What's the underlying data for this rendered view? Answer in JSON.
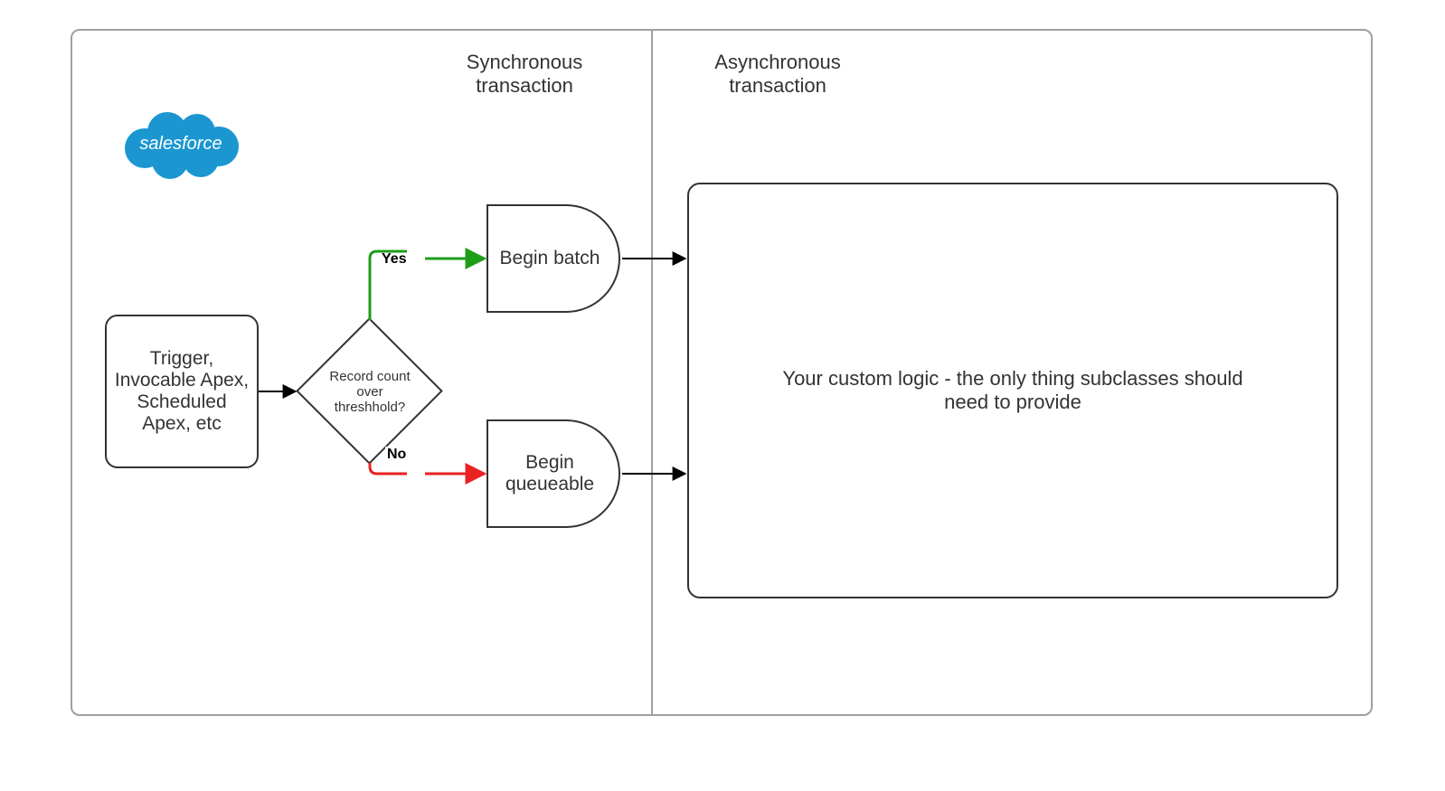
{
  "sections": {
    "sync_title": "Synchronous transaction",
    "async_title": "Asynchronous transaction"
  },
  "logo": {
    "text": "salesforce"
  },
  "nodes": {
    "entry": "Trigger, Invocable Apex, Scheduled Apex, etc",
    "decision": "Record count over threshhold?",
    "begin_batch": "Begin batch",
    "begin_queueable": "Begin queueable",
    "custom_logic": "Your custom logic - the only thing subclasses should need to provide"
  },
  "edges": {
    "yes": "Yes",
    "no": "No"
  },
  "colors": {
    "yes": "#1f9d1a",
    "no": "#e92222",
    "logo": "#1b96d1"
  }
}
